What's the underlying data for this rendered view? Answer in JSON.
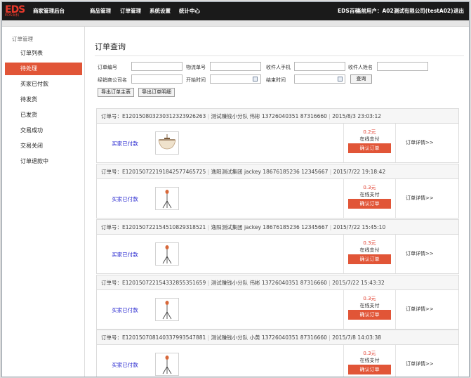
{
  "header": {
    "logo_text": "EDS",
    "logo_sub": "EDS百科",
    "app_name": "商家管理后台",
    "nav": [
      "商品管理",
      "订单管理",
      "系统设置",
      "统计中心"
    ],
    "eds_link": "EDS百科",
    "user_text": "当前用户：A02测试有限公司(testA02)",
    "logout": "退出"
  },
  "sidebar": {
    "title": "订单管理",
    "items": [
      "订单列表",
      "待处理",
      "买家已付款",
      "待发货",
      "已发货",
      "交易成功",
      "交易关闭",
      "订单退款中"
    ],
    "active_index": 1
  },
  "main": {
    "title": "订单查询",
    "filters": {
      "order_no": "订单编号",
      "logistics_no": "物流单号",
      "receiver_phone": "收件人手机",
      "receiver_name": "收件人姓名",
      "dealer_company": "经销商公司名",
      "start_time": "开始时间",
      "end_time": "结束时间",
      "query_btn": "查询"
    },
    "export_main": "导出订单主表",
    "export_detail": "导出订单明细"
  },
  "orders": [
    {
      "order_no": "订单号：E120150803230312323926263",
      "team": "测试赚钱小分队",
      "contact": "伟彬",
      "phone": "13726040351",
      "phone2": "87316660",
      "time": "2015/8/3 23:03:12",
      "status": "买家已付款",
      "price": "0.2元",
      "pay": "在线支付",
      "confirm": "确认订单",
      "detail": "订单详情>>",
      "product": "ceiling-lamp"
    },
    {
      "order_no": "订单号：E120150722191842577465725",
      "team": "逸阳测试集团",
      "contact": "jackey",
      "phone": "18676185236",
      "phone2": "12345667",
      "time": "2015/7/22 19:18:42",
      "status": "买家已付款",
      "price": "0.3元",
      "pay": "在线支付",
      "confirm": "确认订单",
      "detail": "订单详情>>",
      "product": "floor-lamp"
    },
    {
      "order_no": "订单号：E120150722154510829318521",
      "team": "逸阳测试集团",
      "contact": "jackey",
      "phone": "18676185236",
      "phone2": "12345667",
      "time": "2015/7/22 15:45:10",
      "status": "买家已付款",
      "price": "0.3元",
      "pay": "在线支付",
      "confirm": "确认订单",
      "detail": "订单详情>>",
      "product": "floor-lamp"
    },
    {
      "order_no": "订单号：E120150722154332855351659",
      "team": "测试赚钱小分队",
      "contact": "伟彬",
      "phone": "13726040351",
      "phone2": "87316660",
      "time": "2015/7/22 15:43:32",
      "status": "买家已付款",
      "price": "0.3元",
      "pay": "在线支付",
      "confirm": "确认订单",
      "detail": "订单详情>>",
      "product": "floor-lamp"
    },
    {
      "order_no": "订单号：E120150708140337993547881",
      "team": "测试赚钱小分队",
      "contact": "小黄",
      "phone": "13726040351",
      "phone2": "87316660",
      "time": "2015/7/8 14:03:38",
      "status": "买家已付款",
      "price": "0.3元",
      "pay": "在线支付",
      "confirm": "确认订单",
      "detail": "订单详情>>",
      "product": "floor-lamp"
    }
  ],
  "colors": {
    "accent": "#e15537",
    "price": "#e03a2a",
    "status_link": "#2a2ad0",
    "topbar": "#1a1a1a"
  }
}
